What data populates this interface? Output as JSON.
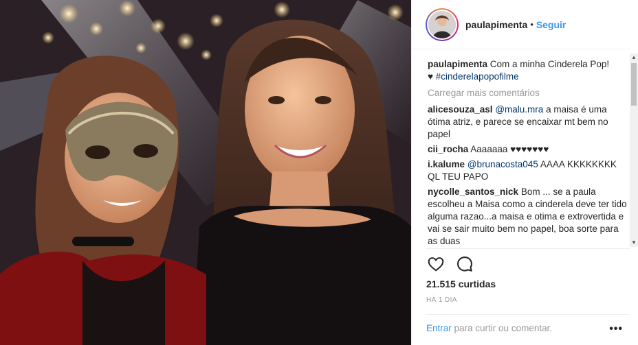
{
  "post": {
    "photo_alt": "Foto do post",
    "owner": "paulapimenta",
    "separator": "•",
    "follow_label": "Seguir",
    "caption": {
      "username": "paulapimenta",
      "text": "Com a minha Cinderela Pop!",
      "prefix": "♥",
      "hashtag": "#cinderelapopofilme"
    },
    "load_more_label": "Carregar mais comentários",
    "comments": [
      {
        "username": "alicesouza_asl",
        "mention": "@malu.mra",
        "text": "a maisa é uma ótima atriz, e parece se encaixar mt bem no papel"
      },
      {
        "username": "cii_rocha",
        "mention": "",
        "text": "Aaaaaaa ♥♥♥♥♥♥♥"
      },
      {
        "username": "i.kalume",
        "mention": "@brunacosta045",
        "text": "AAAA KKKKKKKK QL TEU PAPO"
      },
      {
        "username": "nycolle_santos_nick",
        "mention": "",
        "text": "Bom ... se a paula escolheu a Maisa como a cinderela deve ter tido alguma razao...a maisa e otima e extrovertida e vai se sair muito bem no papel, boa sorte para as duas"
      }
    ],
    "like_icon": "heart-outline-icon",
    "comment_icon": "speech-bubble-icon",
    "likes": "21.515 curtidas",
    "time": "HÁ 1 DIA",
    "login_link": "Entrar",
    "login_text": "para curtir ou comentar.",
    "more_label": "•••",
    "scroll_up": "▲",
    "scroll_down": "▼"
  }
}
